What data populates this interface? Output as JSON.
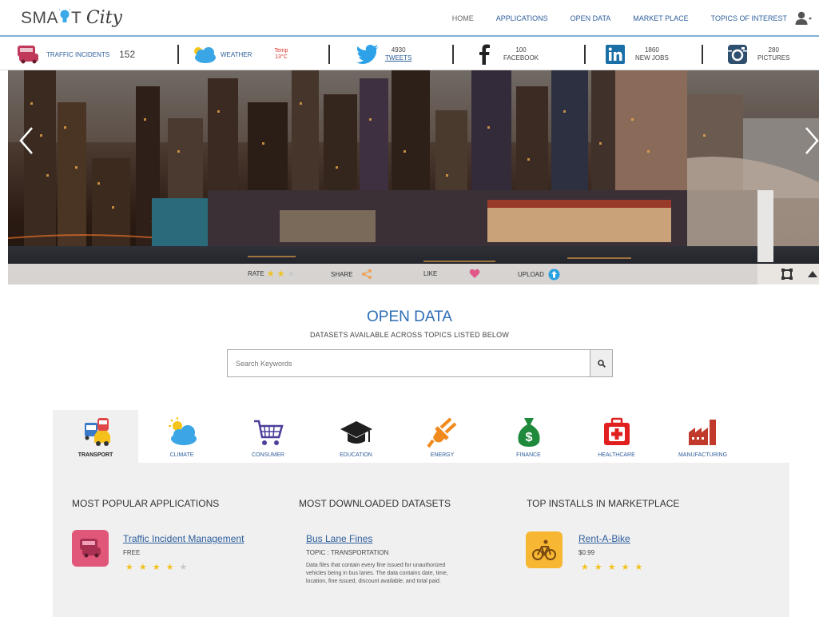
{
  "logo": {
    "part1": "SMA",
    "part2": "T",
    "part3": "City"
  },
  "nav": {
    "items": [
      "HOME",
      "APPLICATIONS",
      "OPEN DATA",
      "MARKET PLACE",
      "TOPICS OF INTEREST"
    ]
  },
  "stats": {
    "traffic": {
      "label": "TRAFFIC INCIDENTS",
      "count": "152"
    },
    "weather": {
      "label": "WEATHER",
      "temp_label": "Temp",
      "temp_value": "13°C"
    },
    "twitter": {
      "count": "4930",
      "label": "TWEETS"
    },
    "facebook": {
      "count": "100",
      "label": "FACEBOOK"
    },
    "linkedin": {
      "count": "1860",
      "label": "NEW JOBS"
    },
    "instagram": {
      "count": "280",
      "label": "PICTURES"
    }
  },
  "hero": {
    "rate_label": "RATE",
    "share_label": "SHARE",
    "like_label": "LIKE",
    "upload_label": "UPLOAD",
    "rating": 2
  },
  "open_data": {
    "title": "OPEN DATA",
    "subtitle": "DATASETS AVAILABLE ACROSS TOPICS LISTED BELOW",
    "search_placeholder": "Search Keywords"
  },
  "tabs": [
    {
      "label": "TRANSPORT",
      "icon": "transport-icon",
      "active": true
    },
    {
      "label": "CLIMATE",
      "icon": "climate-icon"
    },
    {
      "label": "CONSUMER",
      "icon": "consumer-icon"
    },
    {
      "label": "EDUCATION",
      "icon": "education-icon"
    },
    {
      "label": "ENERGY",
      "icon": "energy-icon"
    },
    {
      "label": "FINANCE",
      "icon": "finance-icon"
    },
    {
      "label": "HEALTHCARE",
      "icon": "healthcare-icon"
    },
    {
      "label": "MANUFACTURING",
      "icon": "manufacturing-icon"
    }
  ],
  "panel": {
    "popular": {
      "title": "MOST POPULAR APPLICATIONS",
      "name": "Traffic Incident Management",
      "price": "FREE",
      "rating": 4
    },
    "downloaded": {
      "title": "MOST DOWNLOADED DATASETS",
      "name": "Bus Lane Fines",
      "topic": "TOPIC : TRANSPORTATION",
      "description": "Data files that contain every fine issued for unauthorized vehicles being in bus lanes. The data contains date, time, location, fine issued, discount available, and total paid."
    },
    "marketplace": {
      "title": "TOP INSTALLS IN MARKETPLACE",
      "name": "Rent-A-Bike",
      "price": "$0.99",
      "rating": 5
    }
  },
  "colors": {
    "brand_blue": "#2d5e9c",
    "title_blue": "#2d6db5",
    "star": "#f2c21b",
    "transport_pink": "#e0577a",
    "bike_orange": "#f7b733"
  }
}
